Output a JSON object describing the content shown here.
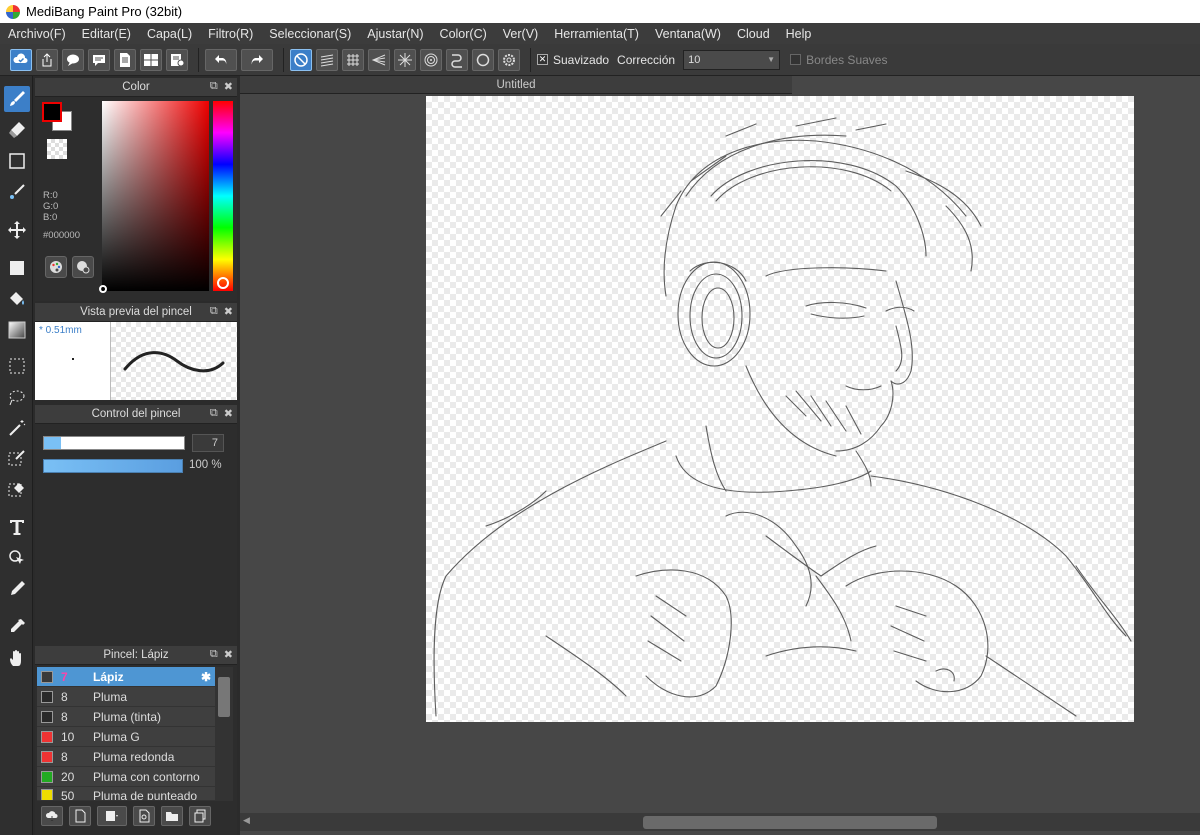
{
  "window": {
    "title": "MediBang Paint Pro (32bit)"
  },
  "menu": [
    "Archivo(F)",
    "Editar(E)",
    "Capa(L)",
    "Filtro(R)",
    "Seleccionar(S)",
    "Ajustar(N)",
    "Color(C)",
    "Ver(V)",
    "Herramienta(T)",
    "Ventana(W)",
    "Cloud",
    "Help"
  ],
  "toolbar": {
    "smoothing_label": "Suavizado",
    "correction_label": "Corrección",
    "correction_value": "10",
    "soft_edges_label": "Bordes Suaves"
  },
  "color_panel": {
    "title": "Color",
    "r": "R:0",
    "g": "G:0",
    "b": "B:0",
    "hex": "#000000",
    "fg_color": "#000000",
    "bg_color": "#ffffff"
  },
  "preview_panel": {
    "title": "Vista previa del pincel",
    "size": "* 0.51mm"
  },
  "control_panel": {
    "title": "Control del pincel",
    "size_value": "7",
    "opacity_value": "100 %",
    "size_fraction": 0.12
  },
  "brush_panel": {
    "title": "Pincel: Lápiz",
    "brushes": [
      {
        "size": "7",
        "name": "Lápiz",
        "color": "#3a3a3a"
      },
      {
        "size": "8",
        "name": "Pluma",
        "color": "#2a2a2a"
      },
      {
        "size": "8",
        "name": "Pluma (tinta)",
        "color": "#2a2a2a"
      },
      {
        "size": "10",
        "name": "Pluma G",
        "color": "#ee3333"
      },
      {
        "size": "8",
        "name": "Pluma redonda",
        "color": "#ee3333"
      },
      {
        "size": "20",
        "name": "Pluma con contorno",
        "color": "#22aa22"
      },
      {
        "size": "50",
        "name": "Pluma de punteado",
        "color": "#eedd00"
      }
    ]
  },
  "document": {
    "tab_title": "Untitled"
  }
}
